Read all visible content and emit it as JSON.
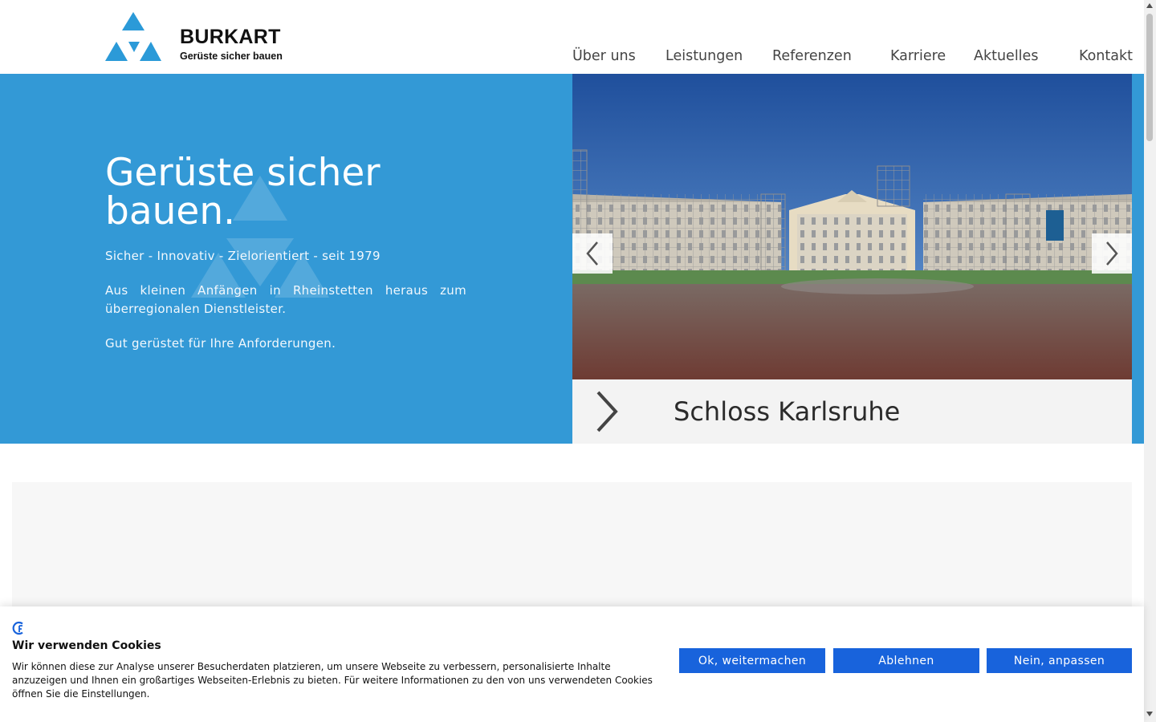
{
  "colors": {
    "brand_blue": "#3399d6",
    "logo_blue": "#2b9ad8",
    "cookie_button": "#1863dc",
    "panel_gray": "#f7f7f7"
  },
  "header": {
    "logo": {
      "name": "BURKART",
      "tagline": "Gerüste sicher bauen",
      "icon": "triangle-logo-icon"
    },
    "nav": [
      {
        "label": "Über uns"
      },
      {
        "label": "Leistungen"
      },
      {
        "label": "Referenzen"
      },
      {
        "label": "Karriere"
      },
      {
        "label": "Aktuelles"
      },
      {
        "label": "Kontakt"
      }
    ]
  },
  "hero": {
    "title": "Gerüste sicher bauen.",
    "paragraphs": [
      "Sicher - Innovativ - Zielorientiert - seit 1979",
      "Aus kleinen Anfängen in Rheinstetten heraus zum überregionalen Dienstleister.",
      "Gut gerüstet für Ihre Anforderungen."
    ]
  },
  "slider": {
    "caption": "Schloss Karlsruhe",
    "prev_icon": "chevron-left-icon",
    "next_icon": "chevron-right-icon",
    "caption_icon": "chevron-right-icon"
  },
  "cookie": {
    "icon": "cookie-consent-icon",
    "title": "Wir verwenden Cookies",
    "text": "Wir können diese zur Analyse unserer Besucherdaten platzieren, um unsere Webseite zu verbessern, personalisierte Inhalte anzuzeigen und Ihnen ein großartiges Webseiten-Erlebnis zu bieten. Für weitere Informationen zu den von uns verwendeten Cookies öffnen Sie die Einstellungen.",
    "buttons": {
      "accept": "Ok, weitermachen",
      "reject": "Ablehnen",
      "customize": "Nein, anpassen"
    }
  }
}
